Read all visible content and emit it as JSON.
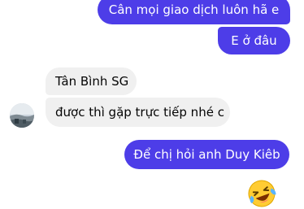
{
  "conversation": {
    "messages": [
      {
        "sender": "self",
        "text": "Cân mọi giao dịch luôn hã e"
      },
      {
        "sender": "self",
        "text": "E ở đâu"
      },
      {
        "sender": "other",
        "text": "Tân Bình SG"
      },
      {
        "sender": "other",
        "text": "được thì gặp trực tiếp nhé c"
      },
      {
        "sender": "self",
        "text": "Để chị hỏi anh Duy Kiêb"
      }
    ],
    "reaction": {
      "icon": "laughing-tears-emoji"
    },
    "avatar": {
      "icon": "landscape-photo"
    }
  },
  "colors": {
    "outgoing_bubble": "#4d3de8",
    "incoming_bubble": "#f0f0f0"
  }
}
